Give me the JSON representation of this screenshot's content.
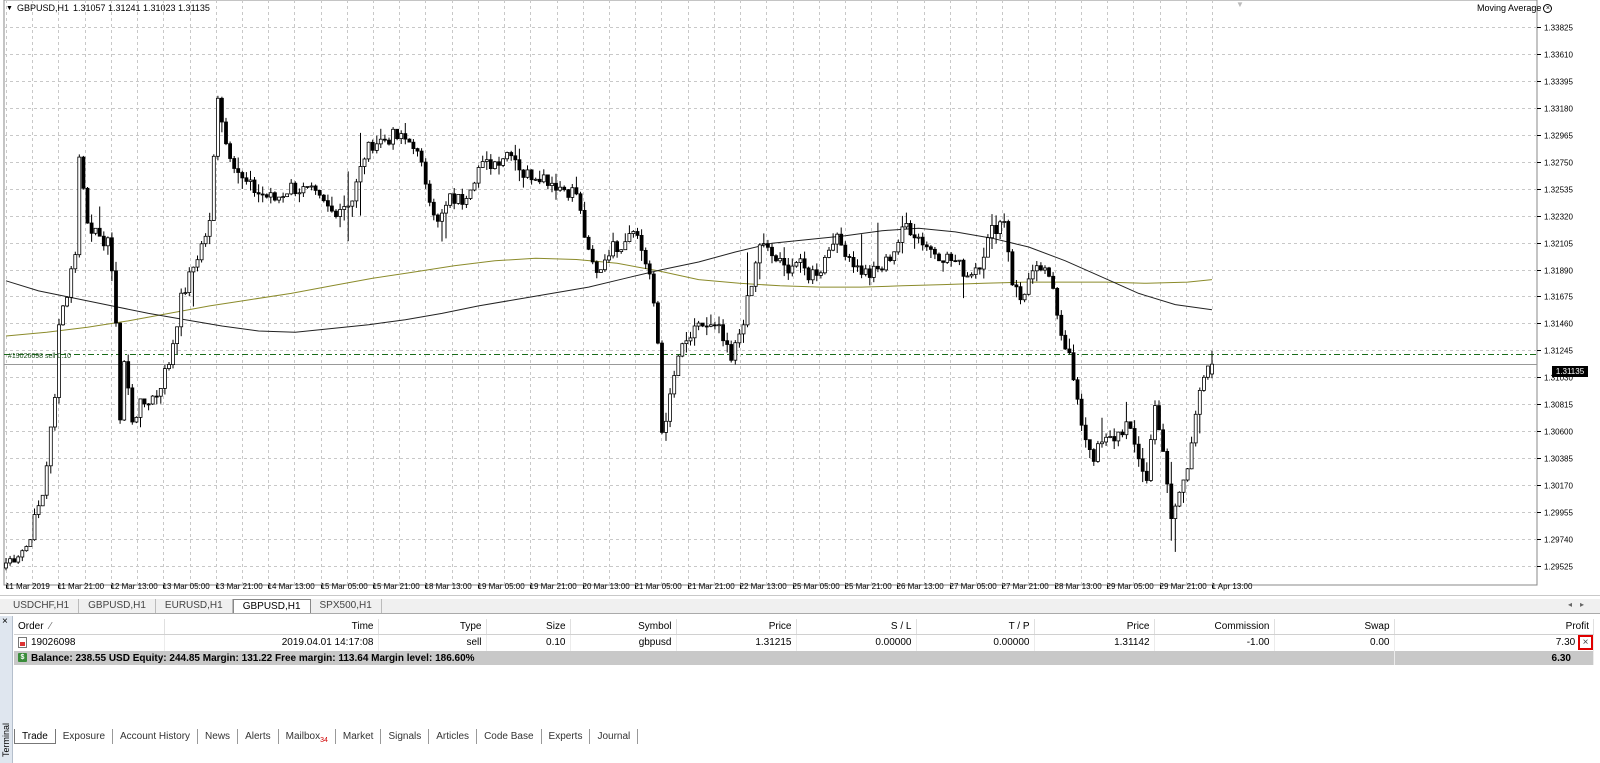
{
  "chart": {
    "header": {
      "symbol": "GBPUSD,H1",
      "quote": "1.31057 1.31241 1.31023 1.31135"
    },
    "indicator": {
      "name": "Moving Average",
      "close_icon": "close-circle-icon"
    },
    "order_line_label": "#19026098 sell 0.10",
    "current_price": "1.31135",
    "price_axis": [
      "1.33825",
      "1.33610",
      "1.33395",
      "1.33180",
      "1.32965",
      "1.32750",
      "1.32535",
      "1.32320",
      "1.32105",
      "1.31890",
      "1.31675",
      "1.31460",
      "1.31245",
      "1.31030",
      "1.30815",
      "1.30600",
      "1.30385",
      "1.30170",
      "1.29955",
      "1.29740",
      "1.29525"
    ],
    "time_axis": [
      "11 Mar 2019",
      "11 Mar 21:00",
      "12 Mar 13:00",
      "13 Mar 05:00",
      "13 Mar 21:00",
      "14 Mar 13:00",
      "15 Mar 05:00",
      "15 Mar 21:00",
      "18 Mar 13:00",
      "19 Mar 05:00",
      "19 Mar 21:00",
      "20 Mar 13:00",
      "21 Mar 05:00",
      "21 Mar 21:00",
      "22 Mar 13:00",
      "25 Mar 05:00",
      "25 Mar 21:00",
      "26 Mar 13:00",
      "27 Mar 05:00",
      "27 Mar 21:00",
      "28 Mar 13:00",
      "29 Mar 05:00",
      "29 Mar 21:00",
      "1 Apr 13:00"
    ],
    "colors": {
      "bull_fill": "#ffffff",
      "bear_fill": "#000000",
      "ma_fast": "#222222",
      "ma_slow": "#8b8b2b",
      "order_line": "#1a6b1a",
      "grid": "#c8c8c8"
    }
  },
  "chart_data": {
    "type": "candlestick",
    "symbol": "GBPUSD",
    "timeframe": "H1",
    "ylim": [
      1.29525,
      1.33825
    ],
    "last_bar": {
      "open": 1.31057,
      "high": 1.31241,
      "low": 1.31023,
      "close": 1.31135
    },
    "order_price": 1.31215,
    "ma_fast": [
      [
        0,
        1.318
      ],
      [
        8,
        1.3172
      ],
      [
        17,
        1.3166
      ],
      [
        26,
        1.316
      ],
      [
        35,
        1.3154
      ],
      [
        44,
        1.3149
      ],
      [
        53,
        1.3144
      ],
      [
        62,
        1.314
      ],
      [
        71,
        1.3139
      ],
      [
        80,
        1.3142
      ],
      [
        89,
        1.3145
      ],
      [
        98,
        1.3149
      ],
      [
        107,
        1.3154
      ],
      [
        116,
        1.316
      ],
      [
        125,
        1.3165
      ],
      [
        134,
        1.317
      ],
      [
        143,
        1.3175
      ],
      [
        152,
        1.3182
      ],
      [
        161,
        1.3189
      ],
      [
        170,
        1.3195
      ],
      [
        179,
        1.3203
      ],
      [
        188,
        1.321
      ],
      [
        197,
        1.3213
      ],
      [
        206,
        1.3216
      ],
      [
        215,
        1.322
      ],
      [
        224,
        1.3222
      ],
      [
        233,
        1.3219
      ],
      [
        242,
        1.3214
      ],
      [
        251,
        1.3207
      ],
      [
        260,
        1.3196
      ],
      [
        269,
        1.3183
      ],
      [
        278,
        1.317
      ],
      [
        287,
        1.3161
      ],
      [
        296,
        1.3157
      ]
    ],
    "ma_slow": [
      [
        0,
        1.3136
      ],
      [
        10,
        1.3139
      ],
      [
        20,
        1.3143
      ],
      [
        30,
        1.3148
      ],
      [
        40,
        1.3154
      ],
      [
        50,
        1.316
      ],
      [
        60,
        1.3165
      ],
      [
        70,
        1.317
      ],
      [
        80,
        1.3176
      ],
      [
        90,
        1.3182
      ],
      [
        100,
        1.3187
      ],
      [
        110,
        1.3192
      ],
      [
        120,
        1.3196
      ],
      [
        130,
        1.3198
      ],
      [
        140,
        1.3197
      ],
      [
        150,
        1.3194
      ],
      [
        160,
        1.3188
      ],
      [
        170,
        1.3181
      ],
      [
        180,
        1.3178
      ],
      [
        190,
        1.3176
      ],
      [
        200,
        1.3175
      ],
      [
        210,
        1.3175
      ],
      [
        220,
        1.3176
      ],
      [
        230,
        1.3177
      ],
      [
        240,
        1.3178
      ],
      [
        250,
        1.3179
      ],
      [
        260,
        1.3179
      ],
      [
        270,
        1.3179
      ],
      [
        280,
        1.3178
      ],
      [
        290,
        1.3179
      ],
      [
        296,
        1.3181
      ]
    ],
    "price_anchors": [
      [
        0,
        1.2955
      ],
      [
        5,
        1.2968
      ],
      [
        9,
        1.301
      ],
      [
        12,
        1.3085
      ],
      [
        13,
        1.315
      ],
      [
        15,
        1.317
      ],
      [
        17,
        1.3205
      ],
      [
        18,
        1.3278
      ],
      [
        20,
        1.323
      ],
      [
        23,
        1.321
      ],
      [
        25,
        1.3215
      ],
      [
        27,
        1.315
      ],
      [
        28,
        1.307
      ],
      [
        29,
        1.3115
      ],
      [
        31,
        1.307
      ],
      [
        33,
        1.308
      ],
      [
        37,
        1.309
      ],
      [
        40,
        1.3115
      ],
      [
        43,
        1.3165
      ],
      [
        47,
        1.32
      ],
      [
        50,
        1.3225
      ],
      [
        52,
        1.333
      ],
      [
        54,
        1.329
      ],
      [
        58,
        1.326
      ],
      [
        62,
        1.325
      ],
      [
        66,
        1.3245
      ],
      [
        70,
        1.3255
      ],
      [
        75,
        1.325
      ],
      [
        80,
        1.3235
      ],
      [
        85,
        1.3245
      ],
      [
        88,
        1.328
      ],
      [
        90,
        1.329
      ],
      [
        95,
        1.3295
      ],
      [
        100,
        1.329
      ],
      [
        103,
        1.326
      ],
      [
        106,
        1.3225
      ],
      [
        109,
        1.3245
      ],
      [
        112,
        1.3245
      ],
      [
        116,
        1.327
      ],
      [
        120,
        1.3275
      ],
      [
        124,
        1.3285
      ],
      [
        127,
        1.3265
      ],
      [
        131,
        1.3265
      ],
      [
        136,
        1.3255
      ],
      [
        140,
        1.325
      ],
      [
        143,
        1.32
      ],
      [
        145,
        1.3185
      ],
      [
        148,
        1.3205
      ],
      [
        151,
        1.321
      ],
      [
        154,
        1.3225
      ],
      [
        156,
        1.3205
      ],
      [
        158,
        1.3185
      ],
      [
        160,
        1.313
      ],
      [
        161,
        1.306
      ],
      [
        163,
        1.3085
      ],
      [
        165,
        1.312
      ],
      [
        168,
        1.3135
      ],
      [
        171,
        1.3145
      ],
      [
        175,
        1.314
      ],
      [
        178,
        1.3115
      ],
      [
        181,
        1.315
      ],
      [
        183,
        1.3175
      ],
      [
        185,
        1.321
      ],
      [
        188,
        1.32
      ],
      [
        191,
        1.319
      ],
      [
        194,
        1.3195
      ],
      [
        197,
        1.3185
      ],
      [
        200,
        1.319
      ],
      [
        203,
        1.3215
      ],
      [
        206,
        1.3205
      ],
      [
        209,
        1.319
      ],
      [
        212,
        1.3185
      ],
      [
        215,
        1.319
      ],
      [
        218,
        1.3205
      ],
      [
        221,
        1.3225
      ],
      [
        224,
        1.3215
      ],
      [
        227,
        1.3205
      ],
      [
        230,
        1.32
      ],
      [
        233,
        1.3195
      ],
      [
        236,
        1.3185
      ],
      [
        239,
        1.3195
      ],
      [
        242,
        1.322
      ],
      [
        245,
        1.323
      ],
      [
        247,
        1.318
      ],
      [
        249,
        1.3165
      ],
      [
        251,
        1.318
      ],
      [
        254,
        1.319
      ],
      [
        257,
        1.3175
      ],
      [
        259,
        1.314
      ],
      [
        261,
        1.312
      ],
      [
        263,
        1.308
      ],
      [
        265,
        1.3055
      ],
      [
        267,
        1.304
      ],
      [
        269,
        1.305
      ],
      [
        272,
        1.3055
      ],
      [
        275,
        1.3065
      ],
      [
        278,
        1.304
      ],
      [
        280,
        1.302
      ],
      [
        282,
        1.3085
      ],
      [
        284,
        1.304
      ],
      [
        286,
        1.299
      ],
      [
        288,
        1.301
      ],
      [
        290,
        1.3035
      ],
      [
        292,
        1.3075
      ],
      [
        294,
        1.31
      ],
      [
        296,
        1.3114
      ]
    ]
  },
  "symbol_tabs": [
    "USDCHF,H1",
    "GBPUSD,H1",
    "EURUSD,H1",
    "GBPUSD,H1",
    "SPX500,H1"
  ],
  "symbol_tabs_active": 3,
  "terminal": {
    "title": "Terminal",
    "columns": [
      "Order",
      "Time",
      "Type",
      "Size",
      "Symbol",
      "Price",
      "S / L",
      "T / P",
      "Price",
      "Commission",
      "Swap",
      "Profit"
    ],
    "orders": [
      {
        "order": "19026098",
        "time": "2019.04.01 14:17:08",
        "type": "sell",
        "size": "0.10",
        "symbol": "gbpusd",
        "price": "1.31215",
        "sl": "0.00000",
        "tp": "0.00000",
        "price_current": "1.31142",
        "commission": "-1.00",
        "swap": "0.00",
        "profit": "7.30"
      }
    ],
    "balance_text": "Balance: 238.55 USD  Equity: 244.85  Margin: 131.22  Free margin: 113.64  Margin level: 186.60%",
    "total_profit": "6.30",
    "tabs": [
      "Trade",
      "Exposure",
      "Account History",
      "News",
      "Alerts",
      "Mailbox",
      "Market",
      "Signals",
      "Articles",
      "Code Base",
      "Experts",
      "Journal"
    ],
    "mailbox_count": "34",
    "active_tab": 0
  }
}
